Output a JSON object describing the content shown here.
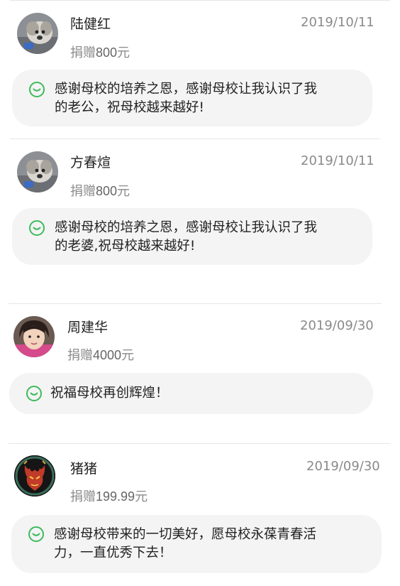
{
  "donors": [
    {
      "name": "陆健红",
      "date": "2019/10/11",
      "donation_prefix": "捐赠",
      "amount": "800",
      "currency": "元",
      "message_line1": "感谢母校的培养之恩，感谢母校让我认识了我",
      "message_line2": "的老公，祝母校越来越好!",
      "avatar": "dog-photo-avatar"
    },
    {
      "name": "方春煊",
      "date": "2019/10/11",
      "donation_prefix": "捐赠",
      "amount": "800",
      "currency": "元",
      "message_line1": "感谢母校的培养之恩，感谢母校让我认识了我",
      "message_line2": "的老婆,祝母校越来越好!",
      "avatar": "dog-photo-avatar"
    },
    {
      "name": "周建华",
      "date": "2019/09/30",
      "donation_prefix": "捐赠",
      "amount": "4000",
      "currency": "元",
      "message_line1": "祝福母校再创辉煌！",
      "message_line2": "",
      "avatar": "child-photo-avatar"
    },
    {
      "name": "猪猪",
      "date": "2019/09/30",
      "donation_prefix": "捐赠",
      "amount": "199.99",
      "currency": "元",
      "message_line1": "感谢母校带来的一切美好，愿母校永葆青春活",
      "message_line2": "力，一直优秀下去！",
      "avatar": "dragon-emblem-avatar"
    }
  ],
  "colors": {
    "accent_green": "#3dbb5c",
    "bubble_bg": "#f4f4f4",
    "muted_text": "#8a8a8a"
  }
}
